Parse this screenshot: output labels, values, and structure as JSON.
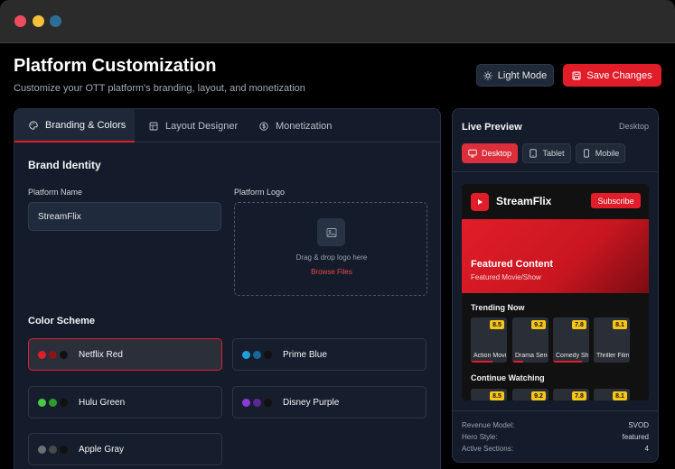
{
  "header": {
    "title": "Platform Customization",
    "subtitle": "Customize your OTT platform's branding, layout, and monetization",
    "light_mode_label": "Light Mode",
    "save_label": "Save Changes"
  },
  "tabs": [
    {
      "label": "Branding & Colors",
      "icon": "palette-icon",
      "active": true
    },
    {
      "label": "Layout Designer",
      "icon": "grid-icon",
      "active": false
    },
    {
      "label": "Monetization",
      "icon": "dollar-icon",
      "active": false
    }
  ],
  "branding": {
    "section_title": "Brand Identity",
    "platform_name_label": "Platform Name",
    "platform_name_value": "StreamFlix",
    "platform_logo_label": "Platform Logo",
    "dropzone_text": "Drag & drop logo here",
    "browse_label": "Browse Files"
  },
  "color_scheme": {
    "section_title": "Color Scheme",
    "schemes": [
      {
        "label": "Netflix Red",
        "colors": [
          "#e11d2a",
          "#8b1218",
          "#111111"
        ],
        "selected": true
      },
      {
        "label": "Prime Blue",
        "colors": [
          "#1ea0d9",
          "#16689a",
          "#111111"
        ],
        "selected": false
      },
      {
        "label": "Hulu Green",
        "colors": [
          "#4cc742",
          "#2f9b2a",
          "#111111"
        ],
        "selected": false
      },
      {
        "label": "Disney Purple",
        "colors": [
          "#8a3bd6",
          "#5d2696",
          "#111111"
        ],
        "selected": false
      },
      {
        "label": "Apple Gray",
        "colors": [
          "#6b6f76",
          "#46494e",
          "#111111"
        ],
        "selected": false
      }
    ]
  },
  "preview": {
    "title": "Live Preview",
    "mode": "Desktop",
    "devices": [
      {
        "label": "Desktop",
        "icon": "monitor-icon",
        "active": true
      },
      {
        "label": "Tablet",
        "icon": "tablet-icon",
        "active": false
      },
      {
        "label": "Mobile",
        "icon": "mobile-icon",
        "active": false
      }
    ],
    "brand": "StreamFlix",
    "subscribe_label": "Subscribe",
    "hero_title": "Featured Content",
    "hero_subtitle": "Featured Movie/Show",
    "trending_title": "Trending Now",
    "trending": [
      {
        "label": "Action Movie",
        "rating": "8.5",
        "progress": 0.6
      },
      {
        "label": "Drama Series",
        "rating": "9.2",
        "progress": 0.3
      },
      {
        "label": "Comedy Show",
        "rating": "7.8",
        "progress": 0.8
      },
      {
        "label": "Thriller Film",
        "rating": "8.1",
        "progress": 0
      }
    ],
    "continue_title": "Continue Watching",
    "continue_ratings": [
      "8.5",
      "9.2",
      "7.8",
      "8.1"
    ],
    "meta": [
      {
        "label": "Revenue Model:",
        "value": "SVOD"
      },
      {
        "label": "Hero Style:",
        "value": "featured"
      },
      {
        "label": "Active Sections:",
        "value": "4"
      }
    ]
  },
  "colors": {
    "accent": "#e11d2a",
    "rating": "#f5c518"
  }
}
